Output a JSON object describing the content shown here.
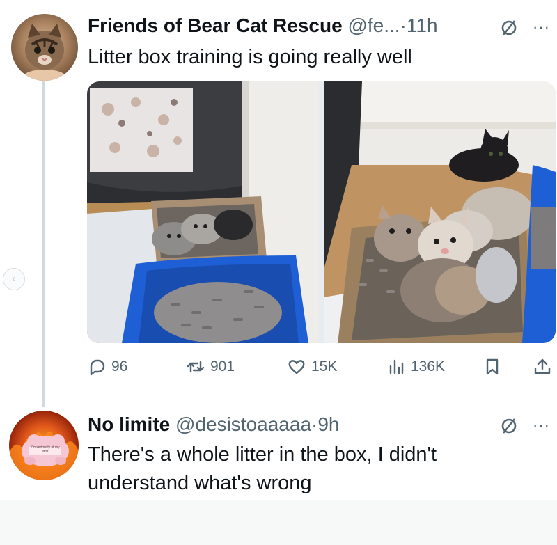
{
  "tweet1": {
    "display_name": "Friends of Bear Cat Rescue",
    "handle": "@fe...",
    "separator": "·",
    "time": "11h",
    "text": "Litter box training is going really well",
    "images": [
      "kittens-in-litter-box-left-photo",
      "kittens-in-box-right-photo"
    ],
    "actions": {
      "replies": "96",
      "reposts": "901",
      "likes": "15K",
      "views": "136K"
    }
  },
  "tweet2": {
    "display_name": "No limite",
    "handle": "@desistoaaaaa",
    "separator": "·",
    "time": "9h",
    "text_line1": "There's a whole litter in the box, I didn't",
    "text_line2": "understand what's wrong",
    "avatar_caption": "I'm seriously at my limit"
  },
  "icons": {
    "reply": "speech-bubble-icon",
    "repost": "repost-arrows-icon",
    "like": "heart-icon",
    "views": "bar-chart-icon",
    "bookmark": "bookmark-icon",
    "share": "share-upload-icon",
    "grok": "grok-slash-circle-icon",
    "more": "more-dots-icon"
  },
  "colors": {
    "text": "#0f1419",
    "muted": "#536471",
    "blue_box": "#1f5fd6"
  }
}
